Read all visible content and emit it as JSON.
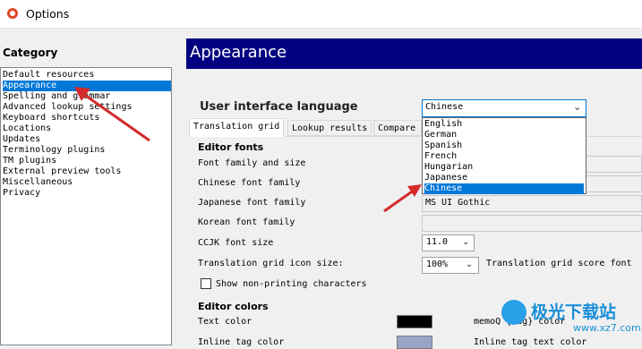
{
  "window": {
    "title": "Options"
  },
  "category": {
    "label": "Category",
    "items": [
      "Default resources",
      "Appearance",
      "Spelling and grammar",
      "Advanced lookup settings",
      "Keyboard shortcuts",
      "Locations",
      "Updates",
      "Terminology plugins",
      "TM plugins",
      "External preview tools",
      "Miscellaneous",
      "Privacy"
    ],
    "selected": "Appearance"
  },
  "header": {
    "title": "Appearance"
  },
  "ui_language": {
    "label": "User interface language",
    "value": "Chinese",
    "options": [
      "English",
      "German",
      "Spanish",
      "French",
      "Hungarian",
      "Japanese",
      "Chinese"
    ],
    "highlighted": "Chinese"
  },
  "tabs": [
    "Translation grid",
    "Lookup results",
    "Compare"
  ],
  "editor_fonts": {
    "title": "Editor fonts",
    "font_family_and_size": "Font family and size",
    "chinese_font_family": "Chinese font family",
    "japanese_font_family": "Japanese font family",
    "japanese_font_value": "MS UI Gothic",
    "korean_font_family": "Korean font family",
    "ccjk_font_size": "CCJK font size",
    "ccjk_font_size_value": "11.0",
    "grid_icon_size": "Translation grid icon size:",
    "grid_icon_size_value": "100%",
    "grid_score_font": "Translation grid score font",
    "show_non_printing": "Show non-printing characters"
  },
  "editor_colors": {
    "title": "Editor colors",
    "text_color": "Text color",
    "text_color_value": "#000000",
    "inline_tag_color": "Inline tag color",
    "inline_tag_color_value": "#9aa3c8",
    "memoq_tag_color": "memoQ {tag} color",
    "inline_tag_text_color": "Inline tag text color"
  },
  "watermark": {
    "text": "极光下载站",
    "url": "www.xz7.com"
  }
}
